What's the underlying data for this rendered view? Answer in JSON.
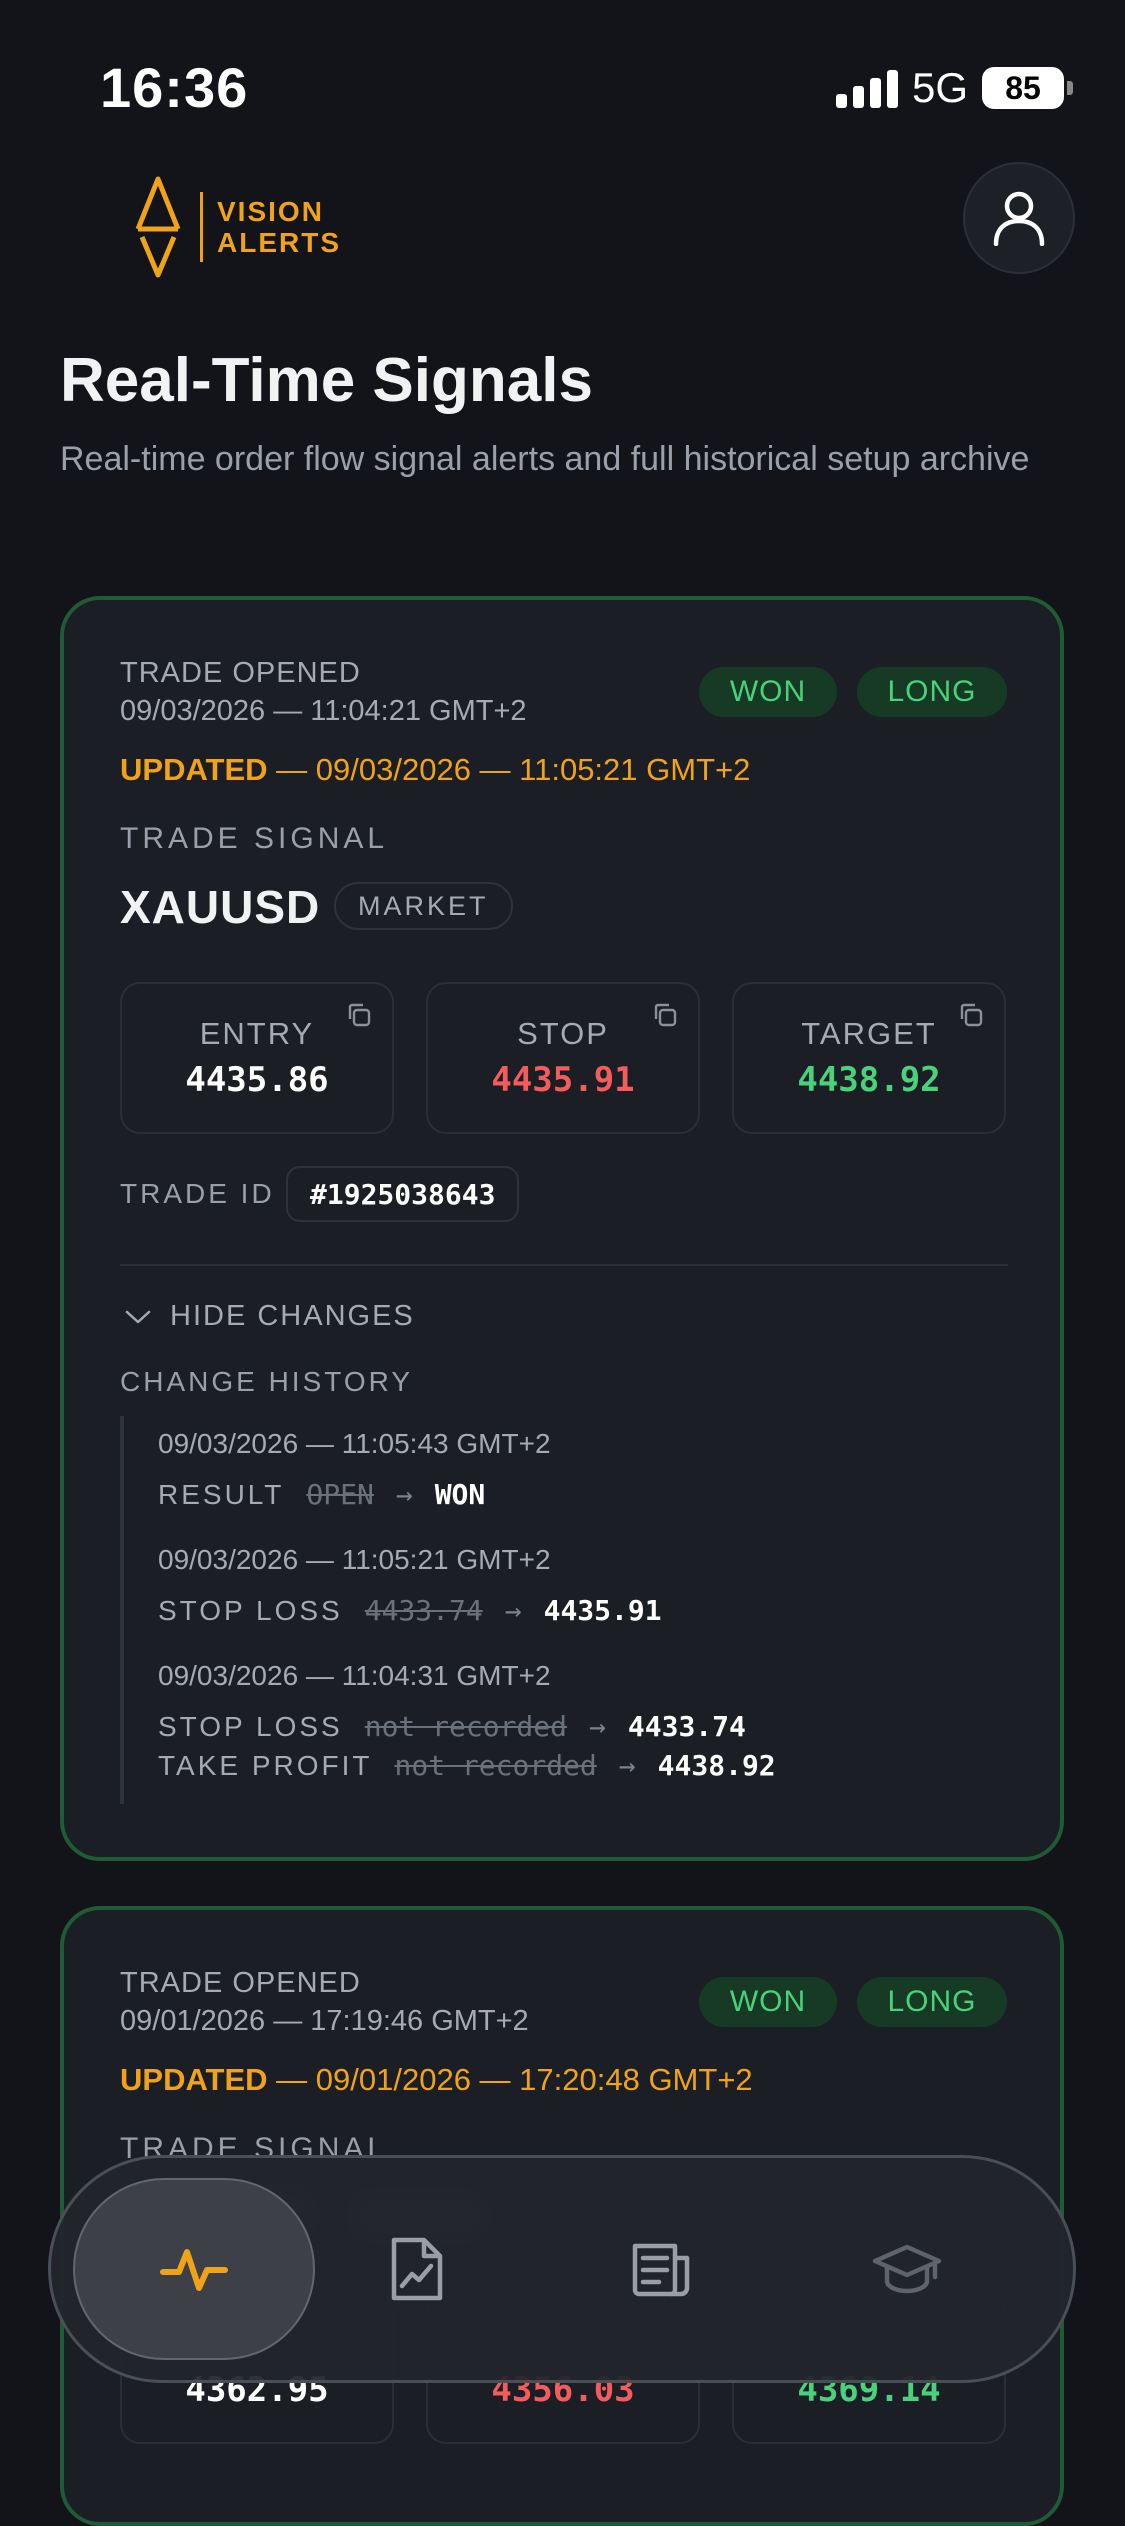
{
  "status_bar": {
    "time": "16:36",
    "network": "5G",
    "battery": "85"
  },
  "header": {
    "logo_line1": "VISION",
    "logo_line2": "ALERTS",
    "profile_icon": "user-icon"
  },
  "page": {
    "title": "Real-Time Signals",
    "subtitle": "Real-time order flow signal alerts and full historical setup archive"
  },
  "signals": [
    {
      "opened_label": "TRADE OPENED",
      "opened_at": "09/03/2026 — 11:04:21 GMT+2",
      "result_badge": "WON",
      "direction_badge": "LONG",
      "updated_prefix": "UPDATED",
      "updated_at": "— 09/03/2026 — 11:05:21 GMT+2",
      "section_label": "TRADE SIGNAL",
      "symbol": "XAUUSD",
      "order_type": "MARKET",
      "entry_label": "ENTRY",
      "entry": "4435.86",
      "stop_label": "STOP",
      "stop": "4435.91",
      "target_label": "TARGET",
      "target": "4438.92",
      "trade_id_label": "TRADE ID",
      "trade_id": "#1925038643",
      "toggle_label": "HIDE CHANGES",
      "history_label": "CHANGE HISTORY",
      "history": [
        {
          "date": "09/03/2026 — 11:05:43 GMT+2",
          "changes": [
            {
              "field": "RESULT",
              "old": "OPEN",
              "new": "WON"
            }
          ]
        },
        {
          "date": "09/03/2026 — 11:05:21 GMT+2",
          "changes": [
            {
              "field": "STOP LOSS",
              "old": "4433.74",
              "new": "4435.91"
            }
          ]
        },
        {
          "date": "09/03/2026 — 11:04:31 GMT+2",
          "changes": [
            {
              "field": "STOP LOSS",
              "old": "not recorded",
              "new": "4433.74"
            },
            {
              "field": "TAKE PROFIT",
              "old": "not recorded",
              "new": "4438.92"
            }
          ]
        }
      ]
    },
    {
      "opened_label": "TRADE OPENED",
      "opened_at": "09/01/2026 — 17:19:46 GMT+2",
      "result_badge": "WON",
      "direction_badge": "LONG",
      "updated_prefix": "UPDATED",
      "updated_at": "— 09/01/2026 — 17:20:48 GMT+2",
      "section_label": "TRADE SIGNAL",
      "entry": "4362.95",
      "stop": "4356.03",
      "target": "4369.14"
    }
  ],
  "bottom_nav": {
    "items": [
      {
        "icon": "pulse-icon",
        "active": true
      },
      {
        "icon": "chart-document-icon",
        "active": false
      },
      {
        "icon": "news-icon",
        "active": false
      },
      {
        "icon": "graduation-cap-icon",
        "active": false
      }
    ]
  },
  "colors": {
    "background": "#121419",
    "card": "#1b1e25",
    "card_border": "#1f5b35",
    "accent": "#f0a319",
    "green": "#49d27b",
    "red": "#f25c5c"
  }
}
